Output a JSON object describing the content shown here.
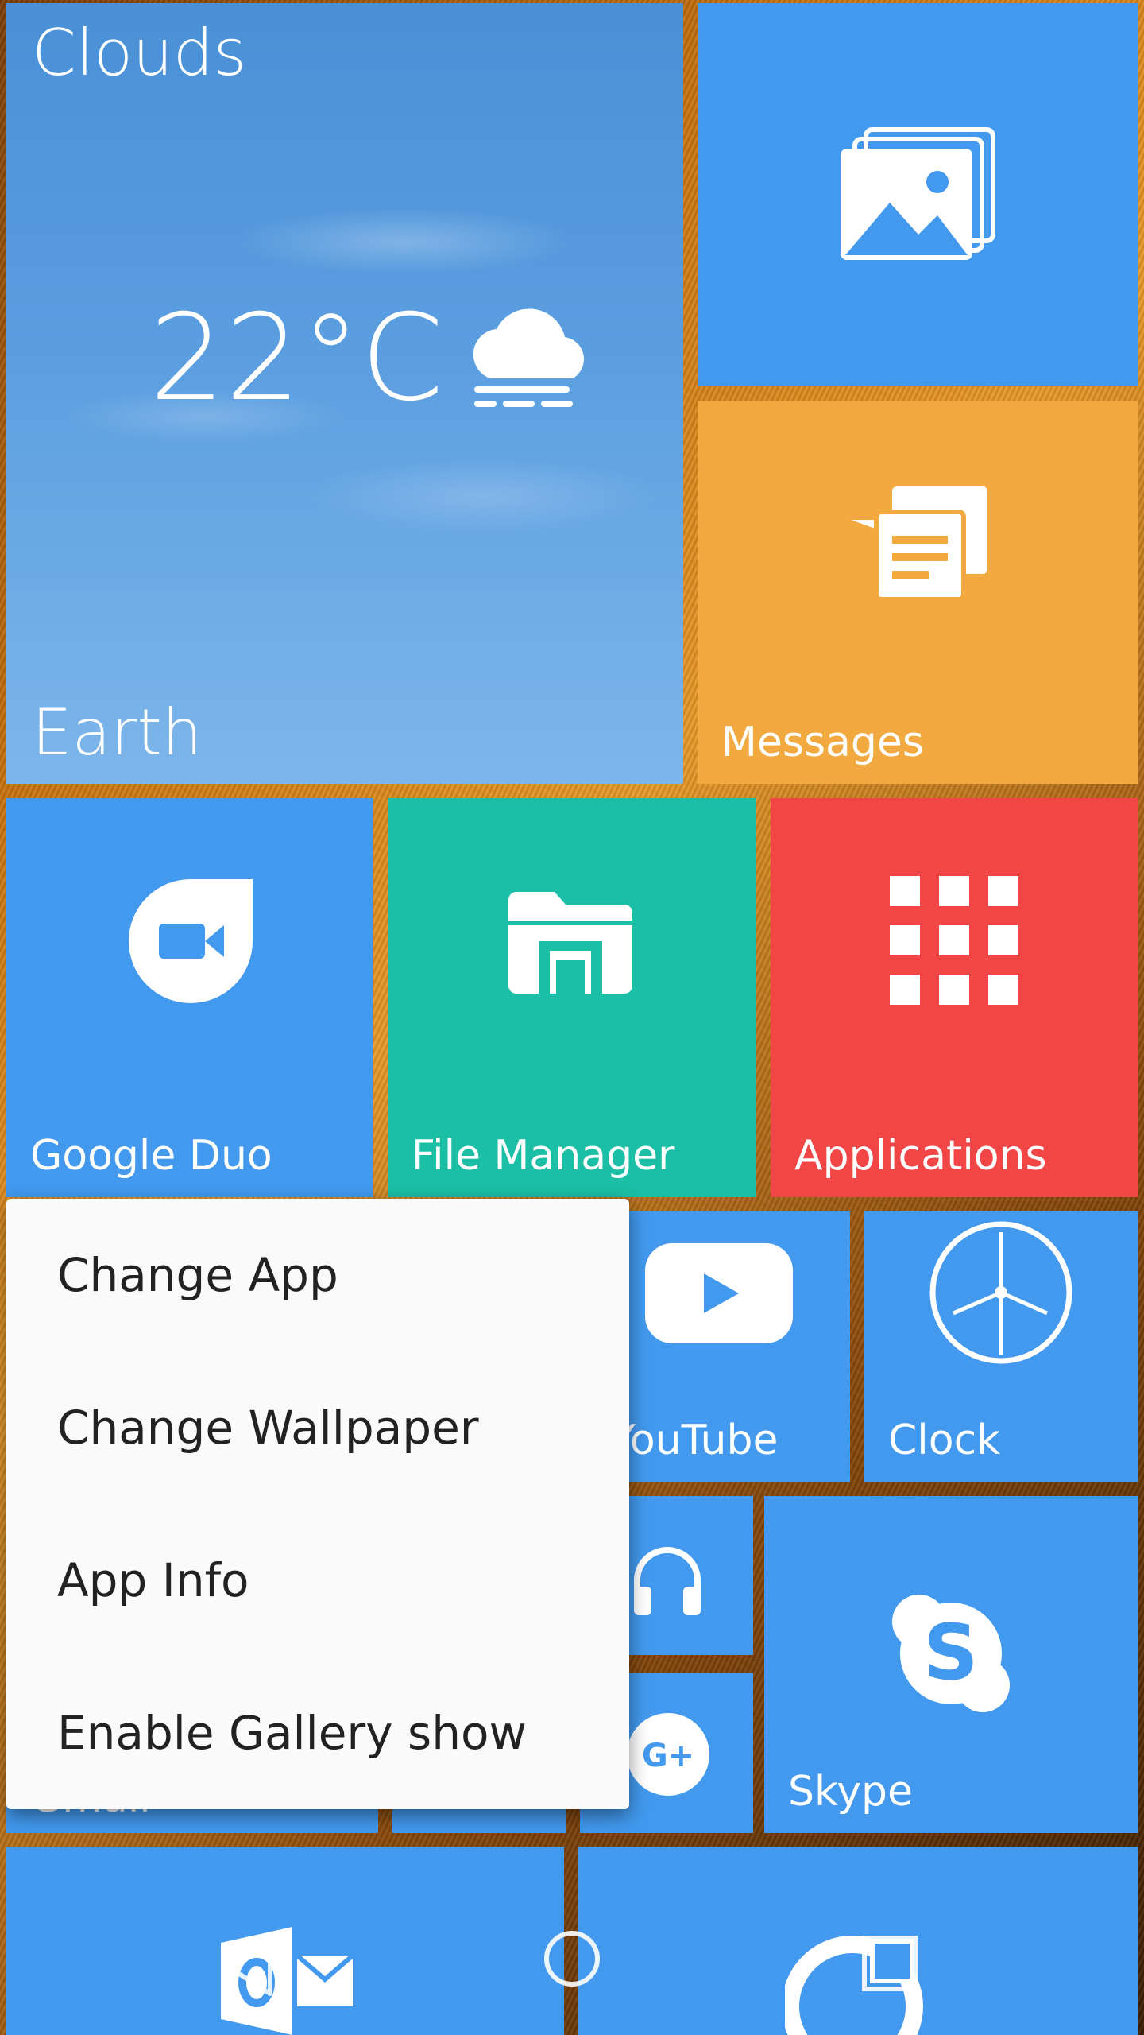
{
  "weather": {
    "condition": "Clouds",
    "temperature": "22°C",
    "location": "Earth",
    "icon": "cloud-fog-icon"
  },
  "tiles": {
    "gallery": {
      "icon": "gallery-icon",
      "color": "#4299ee"
    },
    "messages": {
      "label": "Messages",
      "icon": "messages-icon",
      "color": "#f2aa40"
    },
    "google_duo": {
      "label": "Google Duo",
      "icon": "duo-icon",
      "color": "#4299ee"
    },
    "file_manager": {
      "label": "File Manager",
      "icon": "folder-icon",
      "color": "#1bbfa5"
    },
    "applications": {
      "label": "Applications",
      "icon": "grid-icon",
      "color": "#f24545"
    },
    "youtube": {
      "label": "YouTube",
      "icon": "youtube-icon",
      "color": "#4299ee"
    },
    "clock": {
      "label": "Clock",
      "icon": "clock-icon",
      "color": "#4299ee"
    },
    "music": {
      "icon": "headphones-icon",
      "color": "#4299ee"
    },
    "google_plus": {
      "icon": "google-plus-icon",
      "color": "#4299ee"
    },
    "skype": {
      "label": "Skype",
      "icon": "skype-icon",
      "color": "#4299ee"
    },
    "gmail": {
      "label": "Gmail",
      "color": "#4299ee"
    },
    "outlook": {
      "icon": "outlook-icon",
      "color": "#4299ee"
    },
    "bottom_right": {
      "icon": "pie-chart-icon",
      "color": "#4299ee"
    }
  },
  "context_menu": {
    "items": [
      "Change App",
      "Change Wallpaper",
      "App Info",
      "Enable Gallery show"
    ]
  },
  "nav_bar": {
    "back": "back-icon",
    "home": "home-icon",
    "recents": "recents-icon"
  }
}
